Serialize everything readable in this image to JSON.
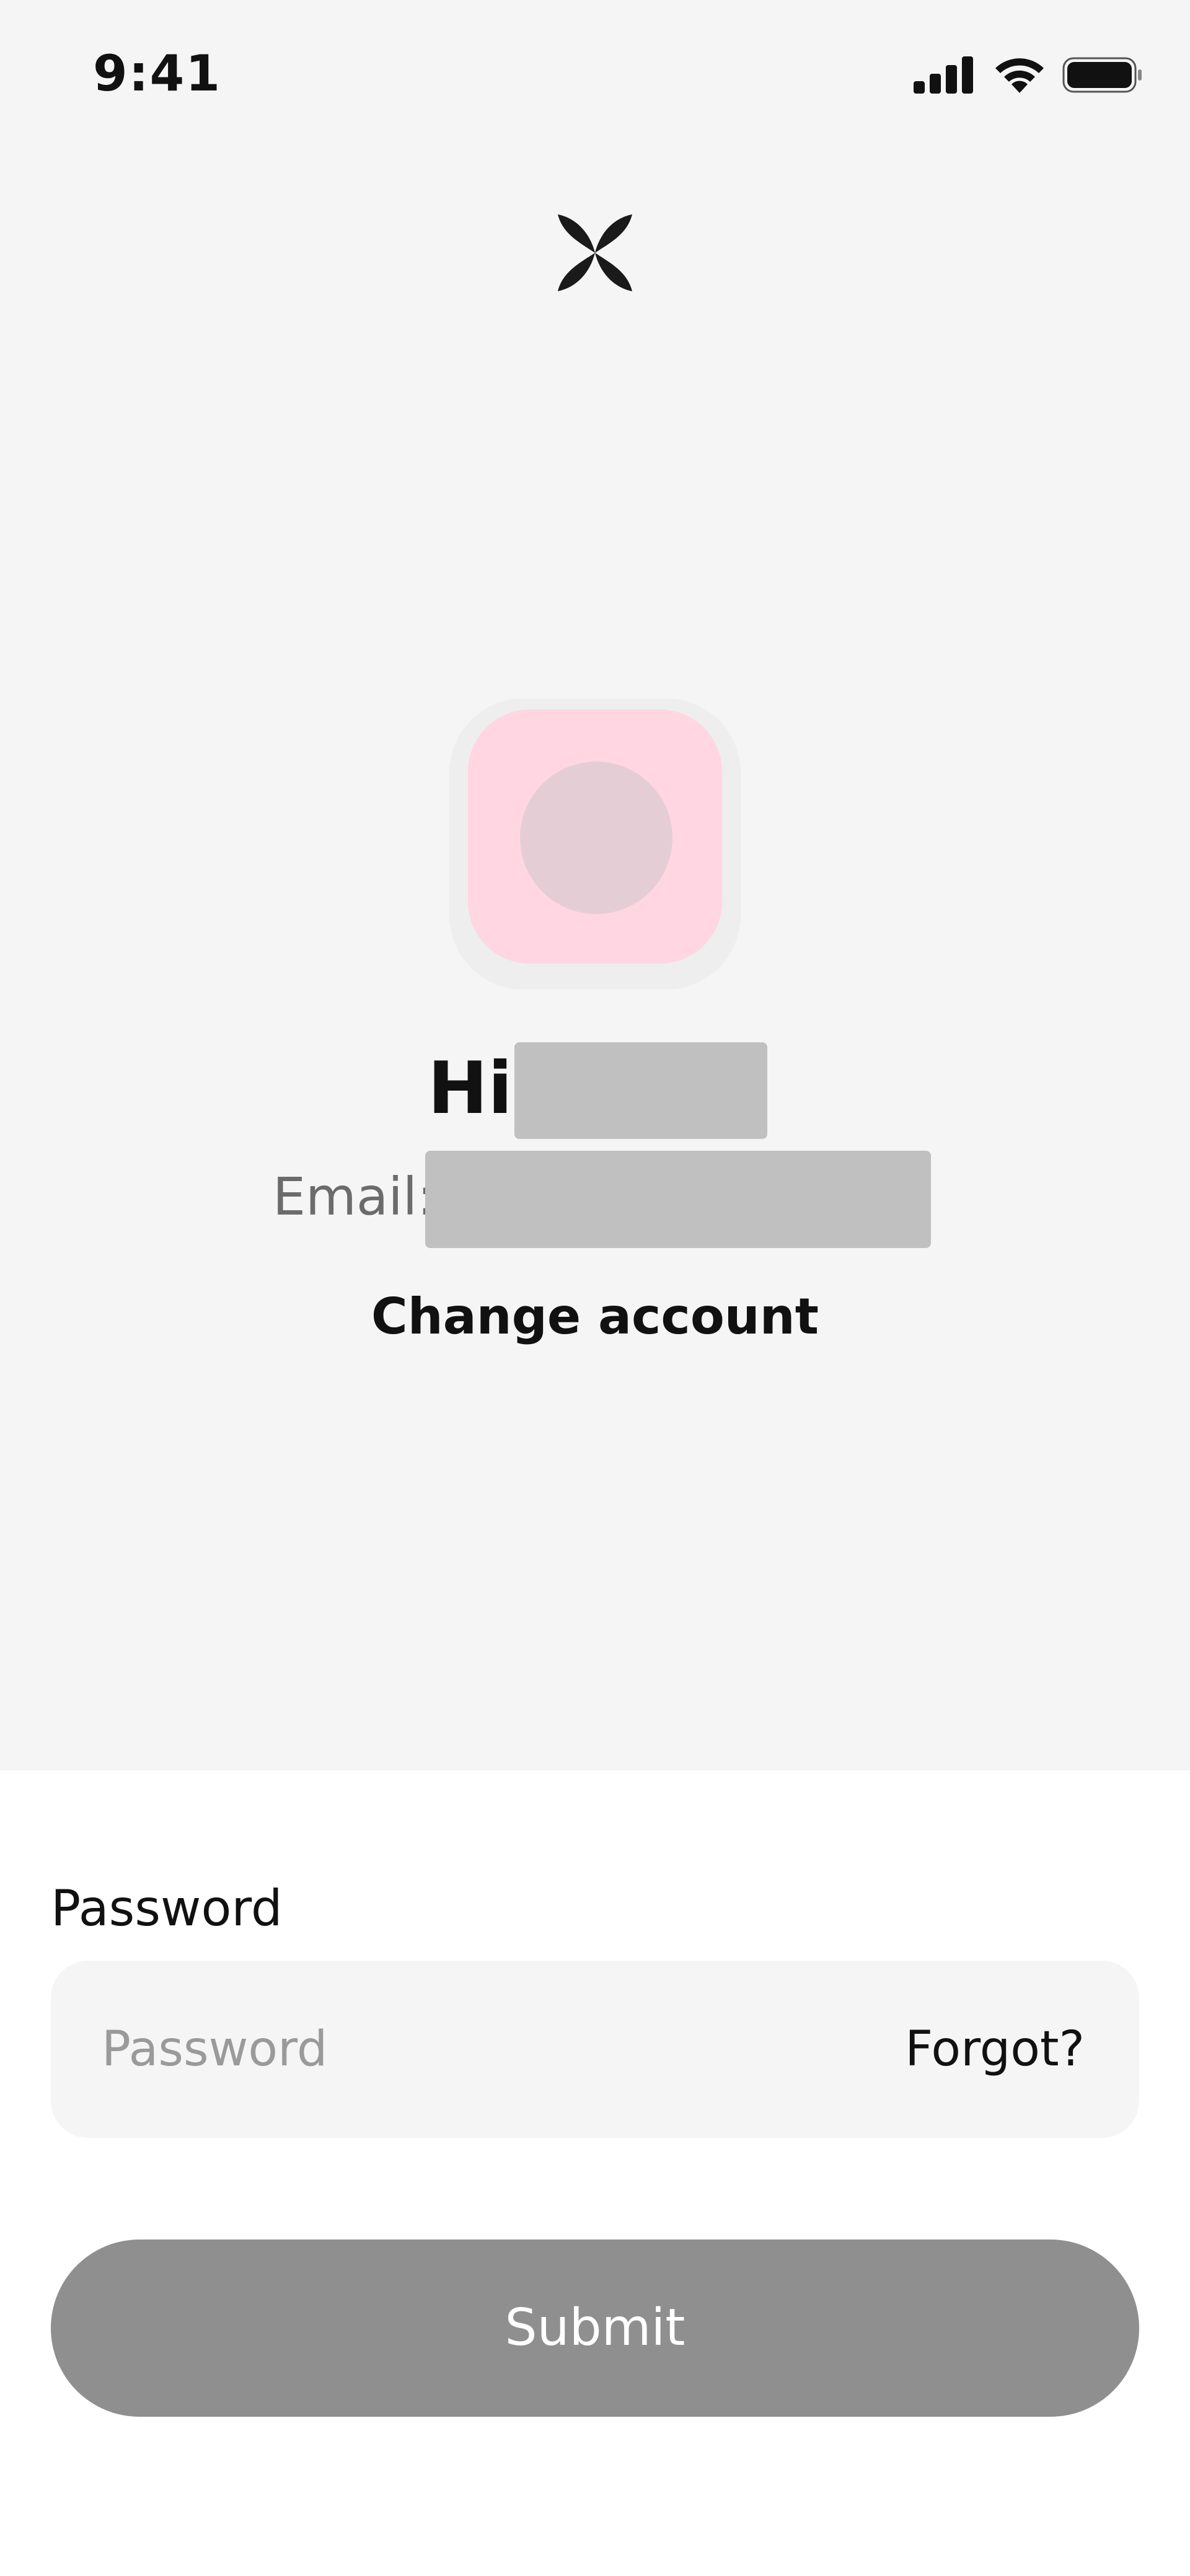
{
  "status_bar": {
    "time": "9:41",
    "icons": [
      "signal-icon",
      "wifi-icon",
      "battery-icon"
    ]
  },
  "brand": {
    "logo_icon": "four-petal-logo-icon"
  },
  "account": {
    "greeting": "Hi",
    "email_label": "Email:",
    "change_account_label": "Change account"
  },
  "form": {
    "password_label": "Password",
    "password_placeholder": "Password",
    "forgot_label": "Forgot?",
    "submit_label": "Submit"
  },
  "colors": {
    "top_background": "#f5f5f5",
    "avatar_background": "#ffd6e2",
    "redaction": "#c0c0c0",
    "submit_disabled": "#8f8f8f"
  }
}
